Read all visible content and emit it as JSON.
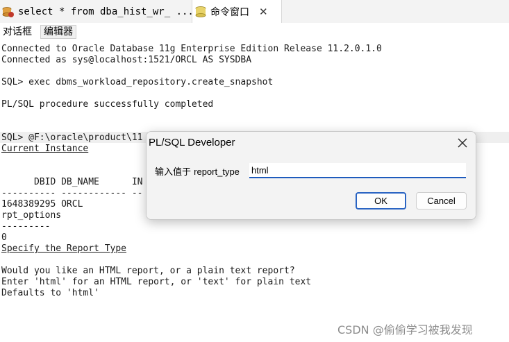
{
  "tabs": [
    {
      "label": "select * from dba_hist_wr_ ...",
      "icon": "sql-window-icon"
    },
    {
      "label": "命令窗口",
      "icon": "command-window-icon",
      "close": "✕"
    }
  ],
  "subtabs": [
    "对话框",
    "编辑器"
  ],
  "console": {
    "line1": "Connected to Oracle Database 11g Enterprise Edition Release 11.2.0.1.0",
    "line2": "Connected as sys@localhost:1521/ORCL AS SYSDBA",
    "line3": "SQL> exec dbms_workload_repository.create_snapshot",
    "line4": "PL/SQL procedure successfully completed",
    "line5": "SQL> @F:\\oracle\\product\\11",
    "line6": "Current Instance",
    "line7": "      DBID DB_NAME      IN",
    "line8": "---------- ------------ --",
    "line9": "1648389295 ORCL",
    "line10": "rpt_options",
    "line11": "---------",
    "line12": "0",
    "line13": "Specify the Report Type",
    "line14": "Would you like an HTML report, or a plain text report?",
    "line15": "Enter 'html' for an HTML report, or 'text' for plain text",
    "line16": "Defaults to 'html'"
  },
  "dialog": {
    "title": "PL/SQL Developer",
    "prompt_prefix": "输入值于 ",
    "prompt_var": "report_type",
    "input_value": "html",
    "ok_label": "OK",
    "cancel_label": "Cancel"
  },
  "watermark": "CSDN @偷偷学习被我发现"
}
